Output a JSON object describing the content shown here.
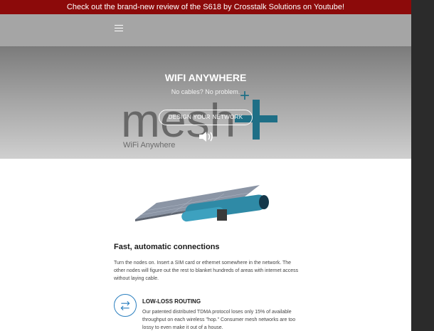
{
  "promo": {
    "text": "Check out the brand-new review of the S618 by Crosstalk Solutions on Youtube!"
  },
  "nav": {
    "menu_icon": "hamburger-menu-icon"
  },
  "hero": {
    "title": "WIFI ANYWHERE",
    "subtitle": "No cables? No problem.",
    "button_label": "DESIGN YOUR NETWORK",
    "logo_text": "mesh",
    "logo_plus": "+",
    "logo_tagline": "WiFi Anywhere",
    "speaker_icon": "speaker-icon",
    "colors": {
      "logo_gray": "#5a5a5a",
      "logo_teal": "#1f6f86"
    }
  },
  "section": {
    "title": "Fast, automatic connections",
    "body": "Turn the nodes on. Insert a SIM card or ethernet somewhere in the network. The other nodes will figure out the rest to blanket hundreds of areas with internet access without laying cable."
  },
  "feature": {
    "icon": "swap-arrows-icon",
    "title": "LOW-LOSS ROUTING",
    "body": "Our patented distributed TDMA protocol loses only 15% of available throughput on each wireless \"hop.\" Consumer mesh networks are too lossy to even make it out of a house."
  },
  "colors": {
    "promo_bg": "#8c0a0a",
    "nav_bg": "#a5a5a5",
    "accent_blue": "#2a7fbf"
  }
}
